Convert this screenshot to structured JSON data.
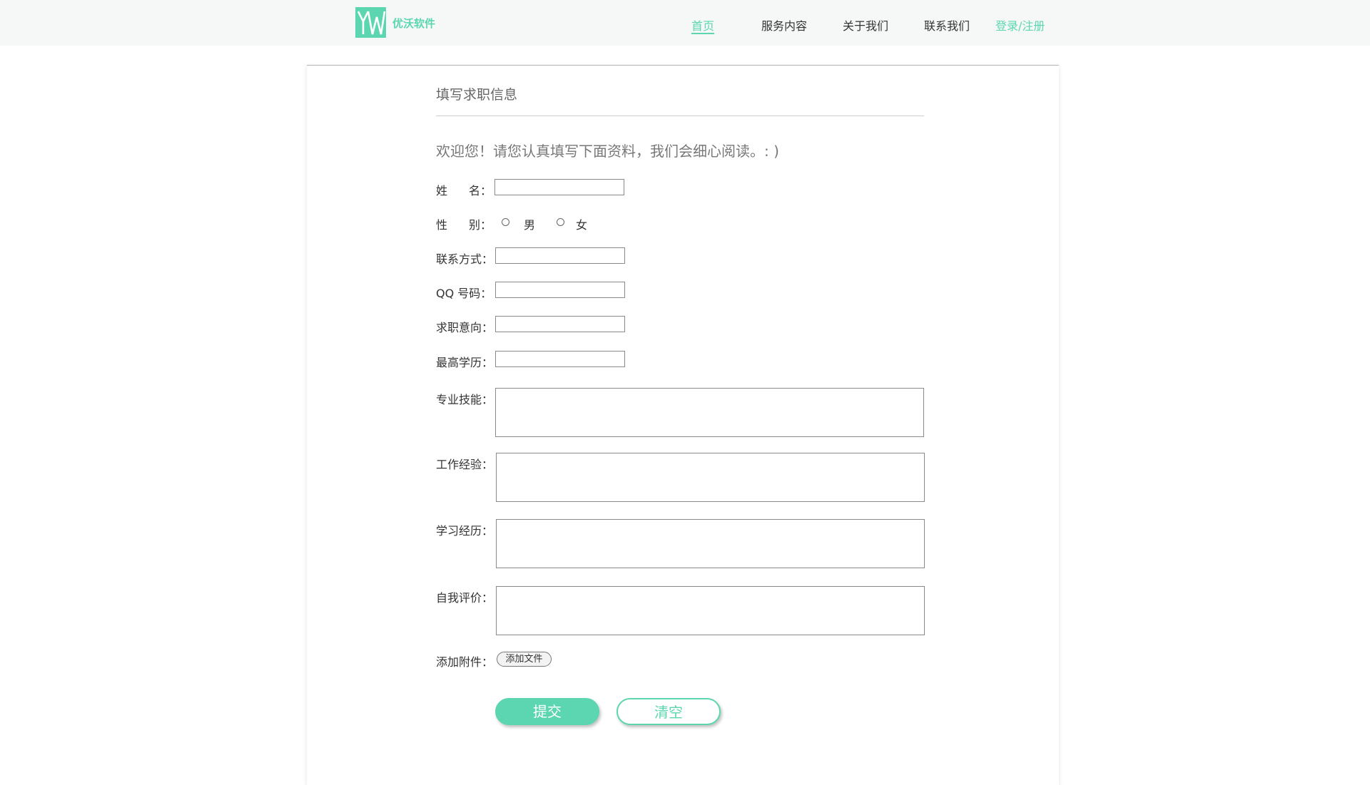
{
  "header": {
    "brand": "优沃软件",
    "logo_letters": "YW",
    "nav": {
      "home": "首页",
      "services": "服务内容",
      "about": "关于我们",
      "contact": "联系我们",
      "login": "登录/注册"
    }
  },
  "form": {
    "title": "填写求职信息",
    "welcome": "欢迎您！请您认真填写下面资料，我们会细心阅读。: )",
    "name_label_a": "姓",
    "name_label_b": "名：",
    "gender_label_a": "性",
    "gender_label_b": "别：",
    "gender_male": "男",
    "gender_female": "女",
    "contact_label": "联系方式：",
    "qq_label": "QQ 号码：",
    "job_label": "求职意向：",
    "education_label": "最高学历：",
    "skills_label": "专业技能：",
    "work_label": "工作经验：",
    "study_label": "学习经历：",
    "self_label": "自我评价：",
    "attach_label": "添加附件：",
    "attach_button": "添加文件",
    "submit": "提交",
    "clear": "清空"
  },
  "colors": {
    "accent": "#5cd6b0"
  }
}
